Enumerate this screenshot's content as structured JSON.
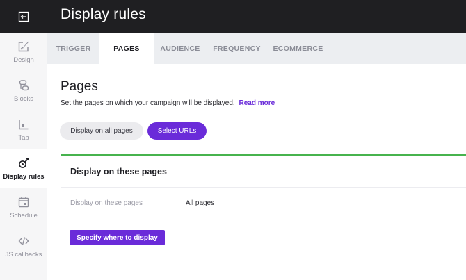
{
  "header": {
    "title": "Display rules"
  },
  "sidebar": {
    "items": [
      {
        "label": "Design",
        "icon": "design-icon"
      },
      {
        "label": "Blocks",
        "icon": "blocks-icon"
      },
      {
        "label": "Tab",
        "icon": "tab-icon"
      },
      {
        "label": "Display rules",
        "icon": "display-rules-icon",
        "active": true
      },
      {
        "label": "Schedule",
        "icon": "schedule-icon"
      },
      {
        "label": "JS callbacks",
        "icon": "code-icon"
      }
    ]
  },
  "tabs": [
    {
      "label": "TRIGGER"
    },
    {
      "label": "PAGES",
      "active": true
    },
    {
      "label": "AUDIENCE"
    },
    {
      "label": "FREQUENCY"
    },
    {
      "label": "ECOMMERCE"
    }
  ],
  "pages": {
    "title": "Pages",
    "description": "Set the pages on which your campaign will be displayed.",
    "read_more": "Read more",
    "option_all": "Display on all pages",
    "option_urls": "Select URLs",
    "selected_option": "Select URLs",
    "card": {
      "title": "Display on these pages",
      "row_label": "Display on these pages",
      "row_value": "All pages",
      "button": "Specify where to display"
    }
  },
  "colors": {
    "accent": "#6a2bd9",
    "success": "#47b34e",
    "topbar": "#1f1f22",
    "sidebar": "#f6f6f7"
  }
}
